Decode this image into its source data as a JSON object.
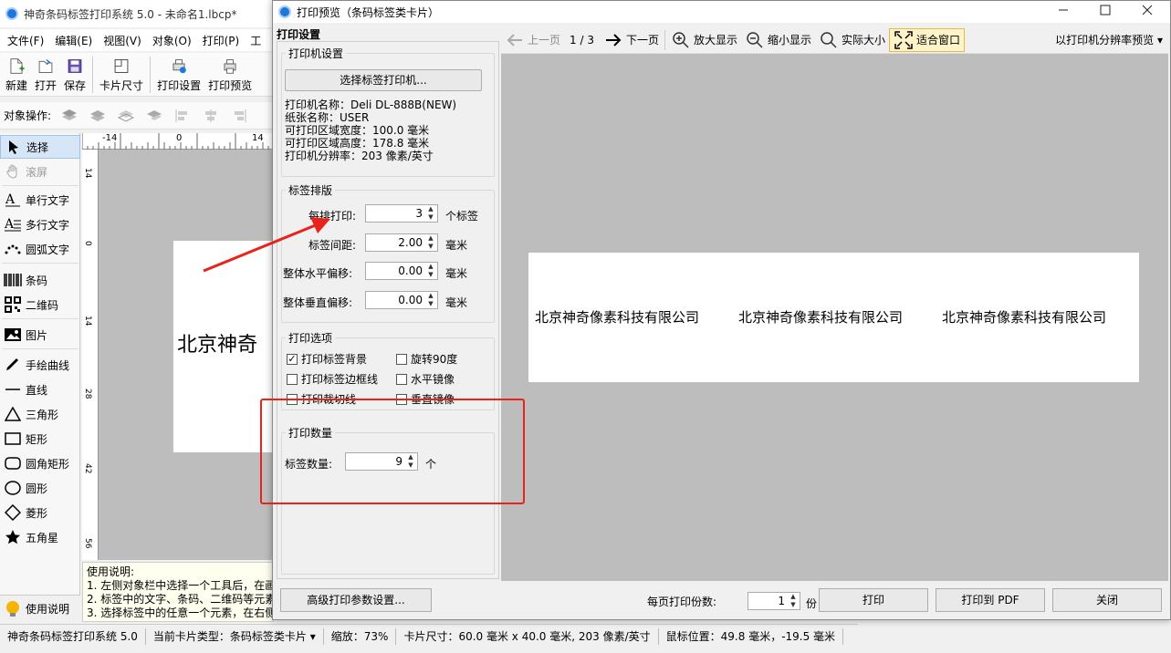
{
  "main": {
    "title": "神奇条码标签打印系统 5.0 - 未命名1.lbcp*",
    "menu": [
      "文件(F)",
      "编辑(E)",
      "视图(V)",
      "对象(O)",
      "打印(P)",
      "工"
    ],
    "toolbar": {
      "new": "新建",
      "open": "打开",
      "save": "保存",
      "card_size": "卡片尺寸",
      "print_settings": "打印设置",
      "print_preview": "打印预览"
    },
    "object_ops_label": "对象操作:",
    "tools": [
      "选择",
      "滚屏",
      "单行文字",
      "多行文字",
      "圆弧文字",
      "条码",
      "二维码",
      "图片",
      "手绘曲线",
      "直线",
      "三角形",
      "矩形",
      "圆角矩形",
      "圆形",
      "菱形",
      "五角星"
    ],
    "help_button": "使用说明",
    "ruler_top": [
      "-14",
      "0",
      "14"
    ],
    "ruler_left": [
      "14",
      "0",
      "14",
      "28",
      "42",
      "56"
    ],
    "canvas_label_text": "北京神奇",
    "help_text": {
      "title": "使用说明:",
      "line1": "1. 左侧对象栏中选择一个工具后，在画",
      "line2": "2. 标签中的文字、条码、二维码等元素",
      "line3": "3. 选择标签中的任意一个元素，在右侧"
    },
    "status": {
      "app": "神奇条码标签打印系统 5.0",
      "card_type": "当前卡片类型：条码标签类卡片",
      "zoom": "缩放：73%",
      "card_size": "卡片尺寸：60.0 毫米 x 40.0 毫米, 203 像素/英寸",
      "mouse": "鼠标位置：49.8 毫米，-19.5 毫米"
    }
  },
  "dialog": {
    "title": "打印预览（条码标签类卡片）",
    "settings_header": "打印设置",
    "printer_group": {
      "legend": "打印机设置",
      "select_button": "选择标签打印机...",
      "printer_name": "打印机名称：Deli DL-888B(NEW)",
      "paper_name": "纸张名称：USER",
      "print_width": "可打印区域宽度：100.0 毫米",
      "print_height": "可打印区域高度：178.8 毫米",
      "resolution": "打印机分辨率：203 像素/英寸"
    },
    "layout_group": {
      "legend": "标签排版",
      "per_row_label": "每排打印:",
      "per_row_value": "3",
      "per_row_unit": "个标签",
      "gap_label": "标签间距:",
      "gap_value": "2.00",
      "gap_unit": "毫米",
      "h_offset_label": "整体水平偏移:",
      "h_offset_value": "0.00",
      "h_offset_unit": "毫米",
      "v_offset_label": "整体垂直偏移:",
      "v_offset_value": "0.00",
      "v_offset_unit": "毫米"
    },
    "options_group": {
      "legend": "打印选项",
      "print_bg": "打印标签背景",
      "print_border": "打印标签边框线",
      "print_cut": "打印裁切线",
      "rotate90": "旋转90度",
      "mirror_h": "水平镜像",
      "mirror_v": "垂直镜像"
    },
    "quantity_group": {
      "legend": "打印数量",
      "count_label": "标签数量:",
      "count_value": "9",
      "count_unit": "个"
    },
    "advanced_button": "高级打印参数设置...",
    "preview_toolbar": {
      "prev": "上一页",
      "page": "1 / 3",
      "next": "下一页",
      "zoom_in": "放大显示",
      "zoom_out": "缩小显示",
      "actual": "实际大小",
      "fit": "适合窗口",
      "resolution_mode": "以打印机分辨率预览 ▾"
    },
    "preview_labels": [
      "北京神奇像素科技有限公司",
      "北京神奇像素科技有限公司",
      "北京神奇像素科技有限公司"
    ],
    "copies_label": "每页打印份数:",
    "copies_value": "1",
    "copies_unit": "份",
    "print_button": "打印",
    "pdf_button": "打印到 PDF",
    "close_button": "关闭"
  },
  "colors": {
    "accent": "#1e78d8",
    "annotation": "#e8231b",
    "canvas_bg": "#bdbdbd"
  }
}
